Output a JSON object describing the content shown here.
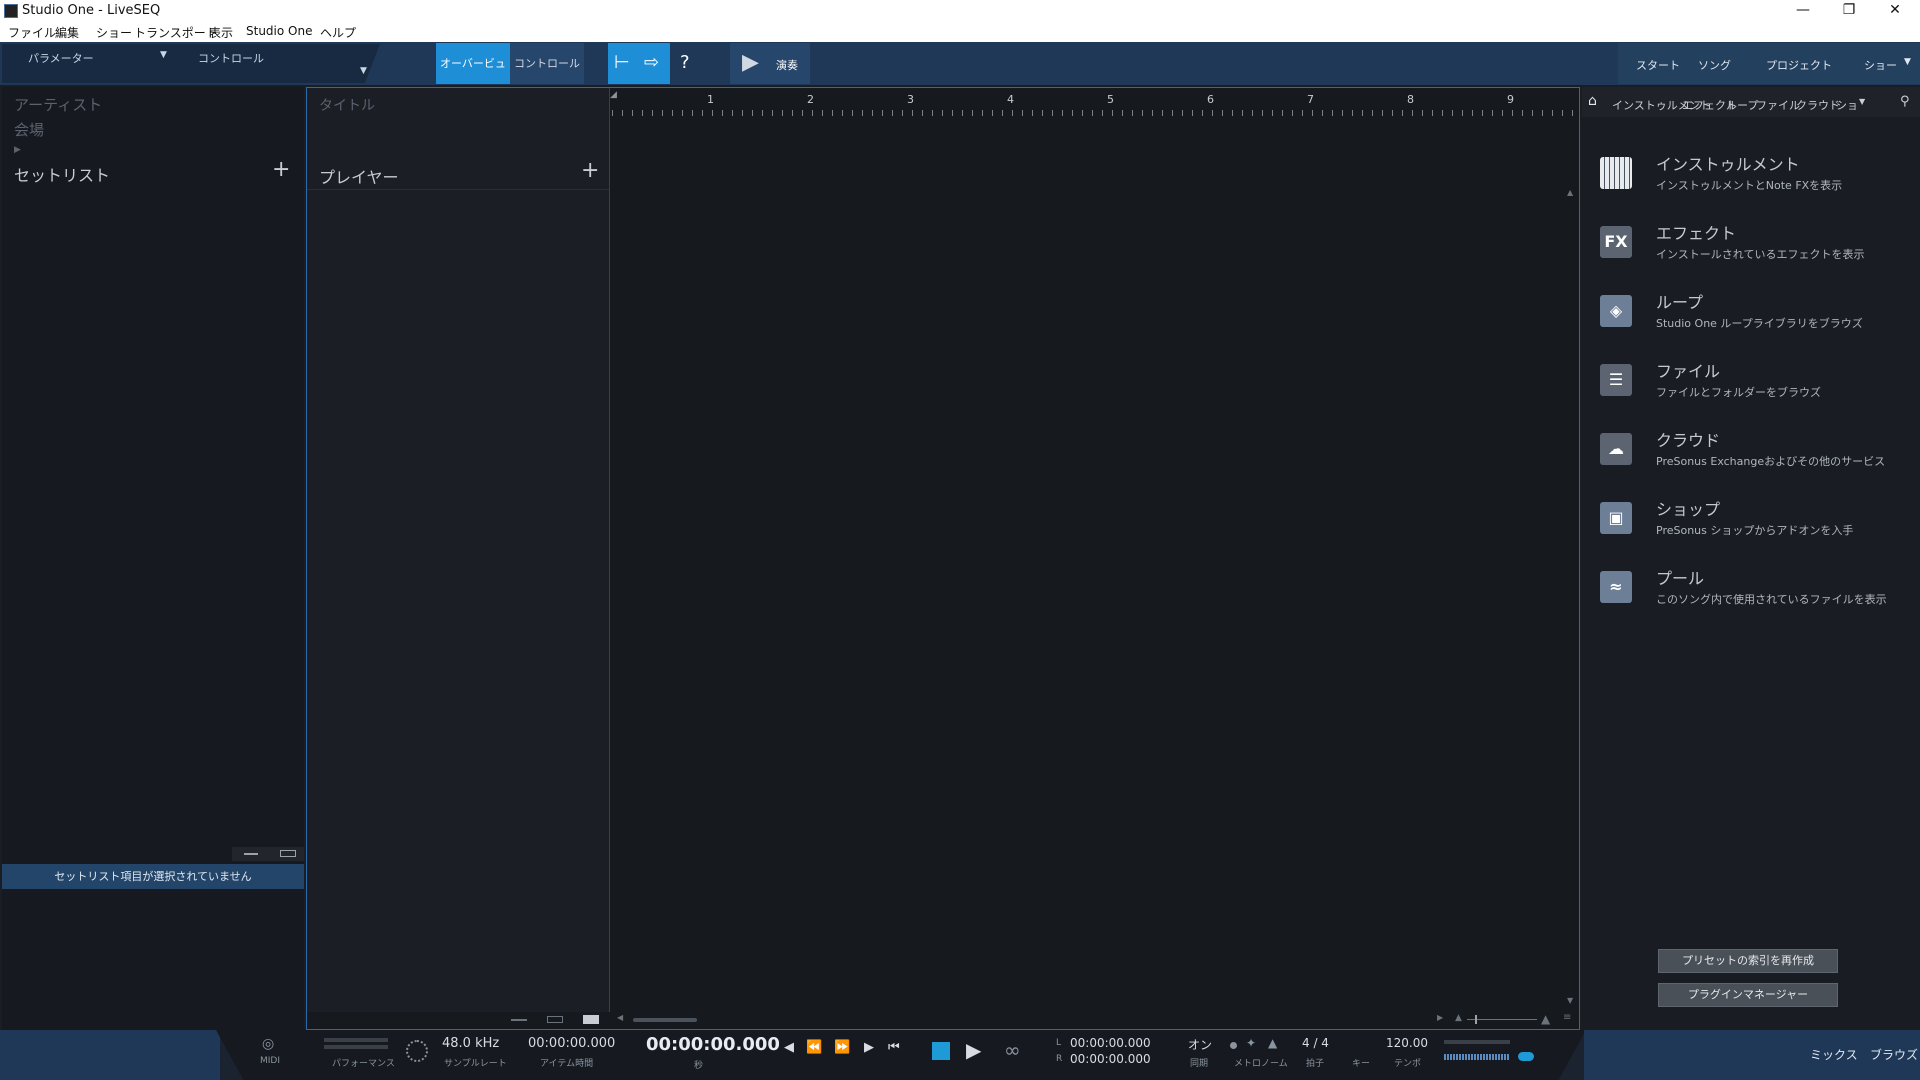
{
  "window": {
    "title": "Studio One - LiveSEQ"
  },
  "menu": [
    "ファイル",
    "編集",
    "ショー",
    "トランスポート",
    "表示",
    "Studio One",
    "ヘルプ"
  ],
  "toolbar": {
    "parameter_label": "パラメーター",
    "control_label": "コントロール",
    "overview_tab": "オーバービュー",
    "control_tab": "コントロール",
    "help_glyph": "?",
    "perform_label": "演奏",
    "right_tabs": [
      "スタート",
      "ソング",
      "プロジェクト",
      "ショー"
    ]
  },
  "left": {
    "artist_placeholder": "アーティスト",
    "venue_placeholder": "会場",
    "setlist_title": "セットリスト",
    "add_glyph": "+",
    "status": "セットリスト項目が選択されていません"
  },
  "center": {
    "title_placeholder": "タイトル",
    "players_title": "プレイヤー",
    "add_glyph": "+",
    "ruler": [
      "1",
      "2",
      "3",
      "4",
      "5",
      "6",
      "7",
      "8",
      "9"
    ]
  },
  "browser": {
    "tabs": [
      "インストゥルメント",
      "エフェクト",
      "ループ",
      "ファイル",
      "クラウド",
      "ショ"
    ],
    "items": [
      {
        "title": "インストゥルメント",
        "desc": "インストゥルメントとNote FXを表示",
        "icon": "piano-icon"
      },
      {
        "title": "エフェクト",
        "desc": "インストールされているエフェクトを表示",
        "icon": "fx-icon",
        "glyph": "FX"
      },
      {
        "title": "ループ",
        "desc": "Studio One ループライブラリをブラウズ",
        "icon": "loop-icon"
      },
      {
        "title": "ファイル",
        "desc": "ファイルとフォルダーをブラウズ",
        "icon": "file-icon"
      },
      {
        "title": "クラウド",
        "desc": "PreSonus Exchangeおよびその他のサービス",
        "icon": "cloud-icon"
      },
      {
        "title": "ショップ",
        "desc": "PreSonus ショップからアドオンを入手",
        "icon": "shop-icon"
      },
      {
        "title": "プール",
        "desc": "このソング内で使用されているファイルを表示",
        "icon": "pool-icon"
      }
    ],
    "reindex_button": "プリセットの索引を再作成",
    "plugin_manager_button": "プラグインマネージャー"
  },
  "transport": {
    "midi_label": "MIDI",
    "performance_label": "パフォーマンス",
    "sample_rate": "48.0 kHz",
    "sample_rate_label": "サンプルレート",
    "item_time": "00:00:00.000",
    "item_time_label": "アイテム時間",
    "time": "00:00:00.000",
    "time_unit": "秒",
    "loop_l_label": "L",
    "loop_l": "00:00:00.000",
    "loop_r_label": "R",
    "loop_r": "00:00:00.000",
    "sync_value": "オン",
    "sync_label": "同期",
    "metronome_label": "メトロノーム",
    "time_sig": "4 / 4",
    "time_sig_label": "拍子",
    "key_label": "キー",
    "tempo": "120.00",
    "tempo_label": "テンポ",
    "mix_button": "ミックス",
    "browse_button": "ブラウズ"
  },
  "colors": {
    "accent": "#1e8fd6",
    "toolbar": "#1f3857",
    "panel": "#161a20"
  }
}
